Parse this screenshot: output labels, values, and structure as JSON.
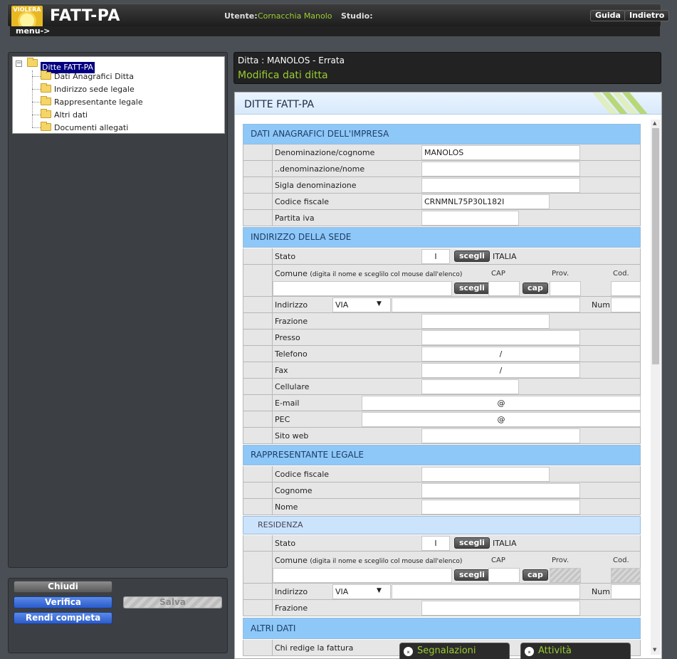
{
  "header": {
    "logo_text": "VIOLERA",
    "app_title": "FATT-PA",
    "user_label": "Utente:",
    "user_name": "Cornacchia Manolo",
    "studio_label": "Studio:",
    "guida": "Guida",
    "indietro": "Indietro",
    "menu": "menu->"
  },
  "tree": {
    "minus": "−",
    "root": "Ditte FATT-PA",
    "items": [
      "Dati Anagrafici Ditta",
      "Indirizzo sede legale",
      "Rappresentante legale",
      "Altri dati",
      "Documenti allegati"
    ]
  },
  "buttons": {
    "chiudi": "Chiudi",
    "verifica": "Verifica",
    "rendi": "Rendi completa",
    "salva": "Salva"
  },
  "right": {
    "ditta": "Ditta : MANOLOS - Errata",
    "subtitle": "Modifica dati ditta"
  },
  "form": {
    "title": "DITTE FATT-PA",
    "sec_anagrafici": "DATI ANAGRAFICI DELL'IMPRESA",
    "denominazione_label": "Denominazione/cognome",
    "denominazione_value": "MANOLOS",
    "denominazione2_label": "..denominazione/nome",
    "sigla_label": "Sigla denominazione",
    "cf_label": "Codice fiscale",
    "cf_value": "CRNMNL75P30L182I",
    "piva_label": "Partita iva",
    "sec_sede": "INDIRIZZO DELLA SEDE",
    "stato_label": "Stato",
    "stato_code": "I",
    "scegli": "scegli",
    "stato_name": "ITALIA",
    "comune_label": "Comune",
    "comune_hint": "(digita il nome e sceglilo col mouse dall'elenco)",
    "cap_hdr": "CAP",
    "prov_hdr": "Prov.",
    "cod_hdr": "Cod.",
    "cap_btn": "cap",
    "indirizzo_label": "Indirizzo",
    "via_value": "VIA",
    "via_arrow": "▼",
    "num_label": "Num.",
    "frazione_label": "Frazione",
    "presso_label": "Presso",
    "telefono_label": "Telefono",
    "fax_label": "Fax",
    "slash": "/",
    "cellulare_label": "Cellulare",
    "email_label": "E-mail",
    "pec_label": "PEC",
    "at": "@",
    "sito_label": "Sito web",
    "sec_rapp": "RAPPRESENTANTE LEGALE",
    "rapp_cf_label": "Codice fiscale",
    "cognome_label": "Cognome",
    "nome_label": "Nome",
    "residenza": "RESIDENZA",
    "sec_altri": "ALTRI DATI",
    "chi_redige_label": "Chi redige la fattura",
    "scroll_up": "▲",
    "scroll_down": "▼"
  },
  "tabs": {
    "segnalazioni": "Segnalazioni",
    "attivita": "Attività",
    "tab_icon": "⌅"
  }
}
